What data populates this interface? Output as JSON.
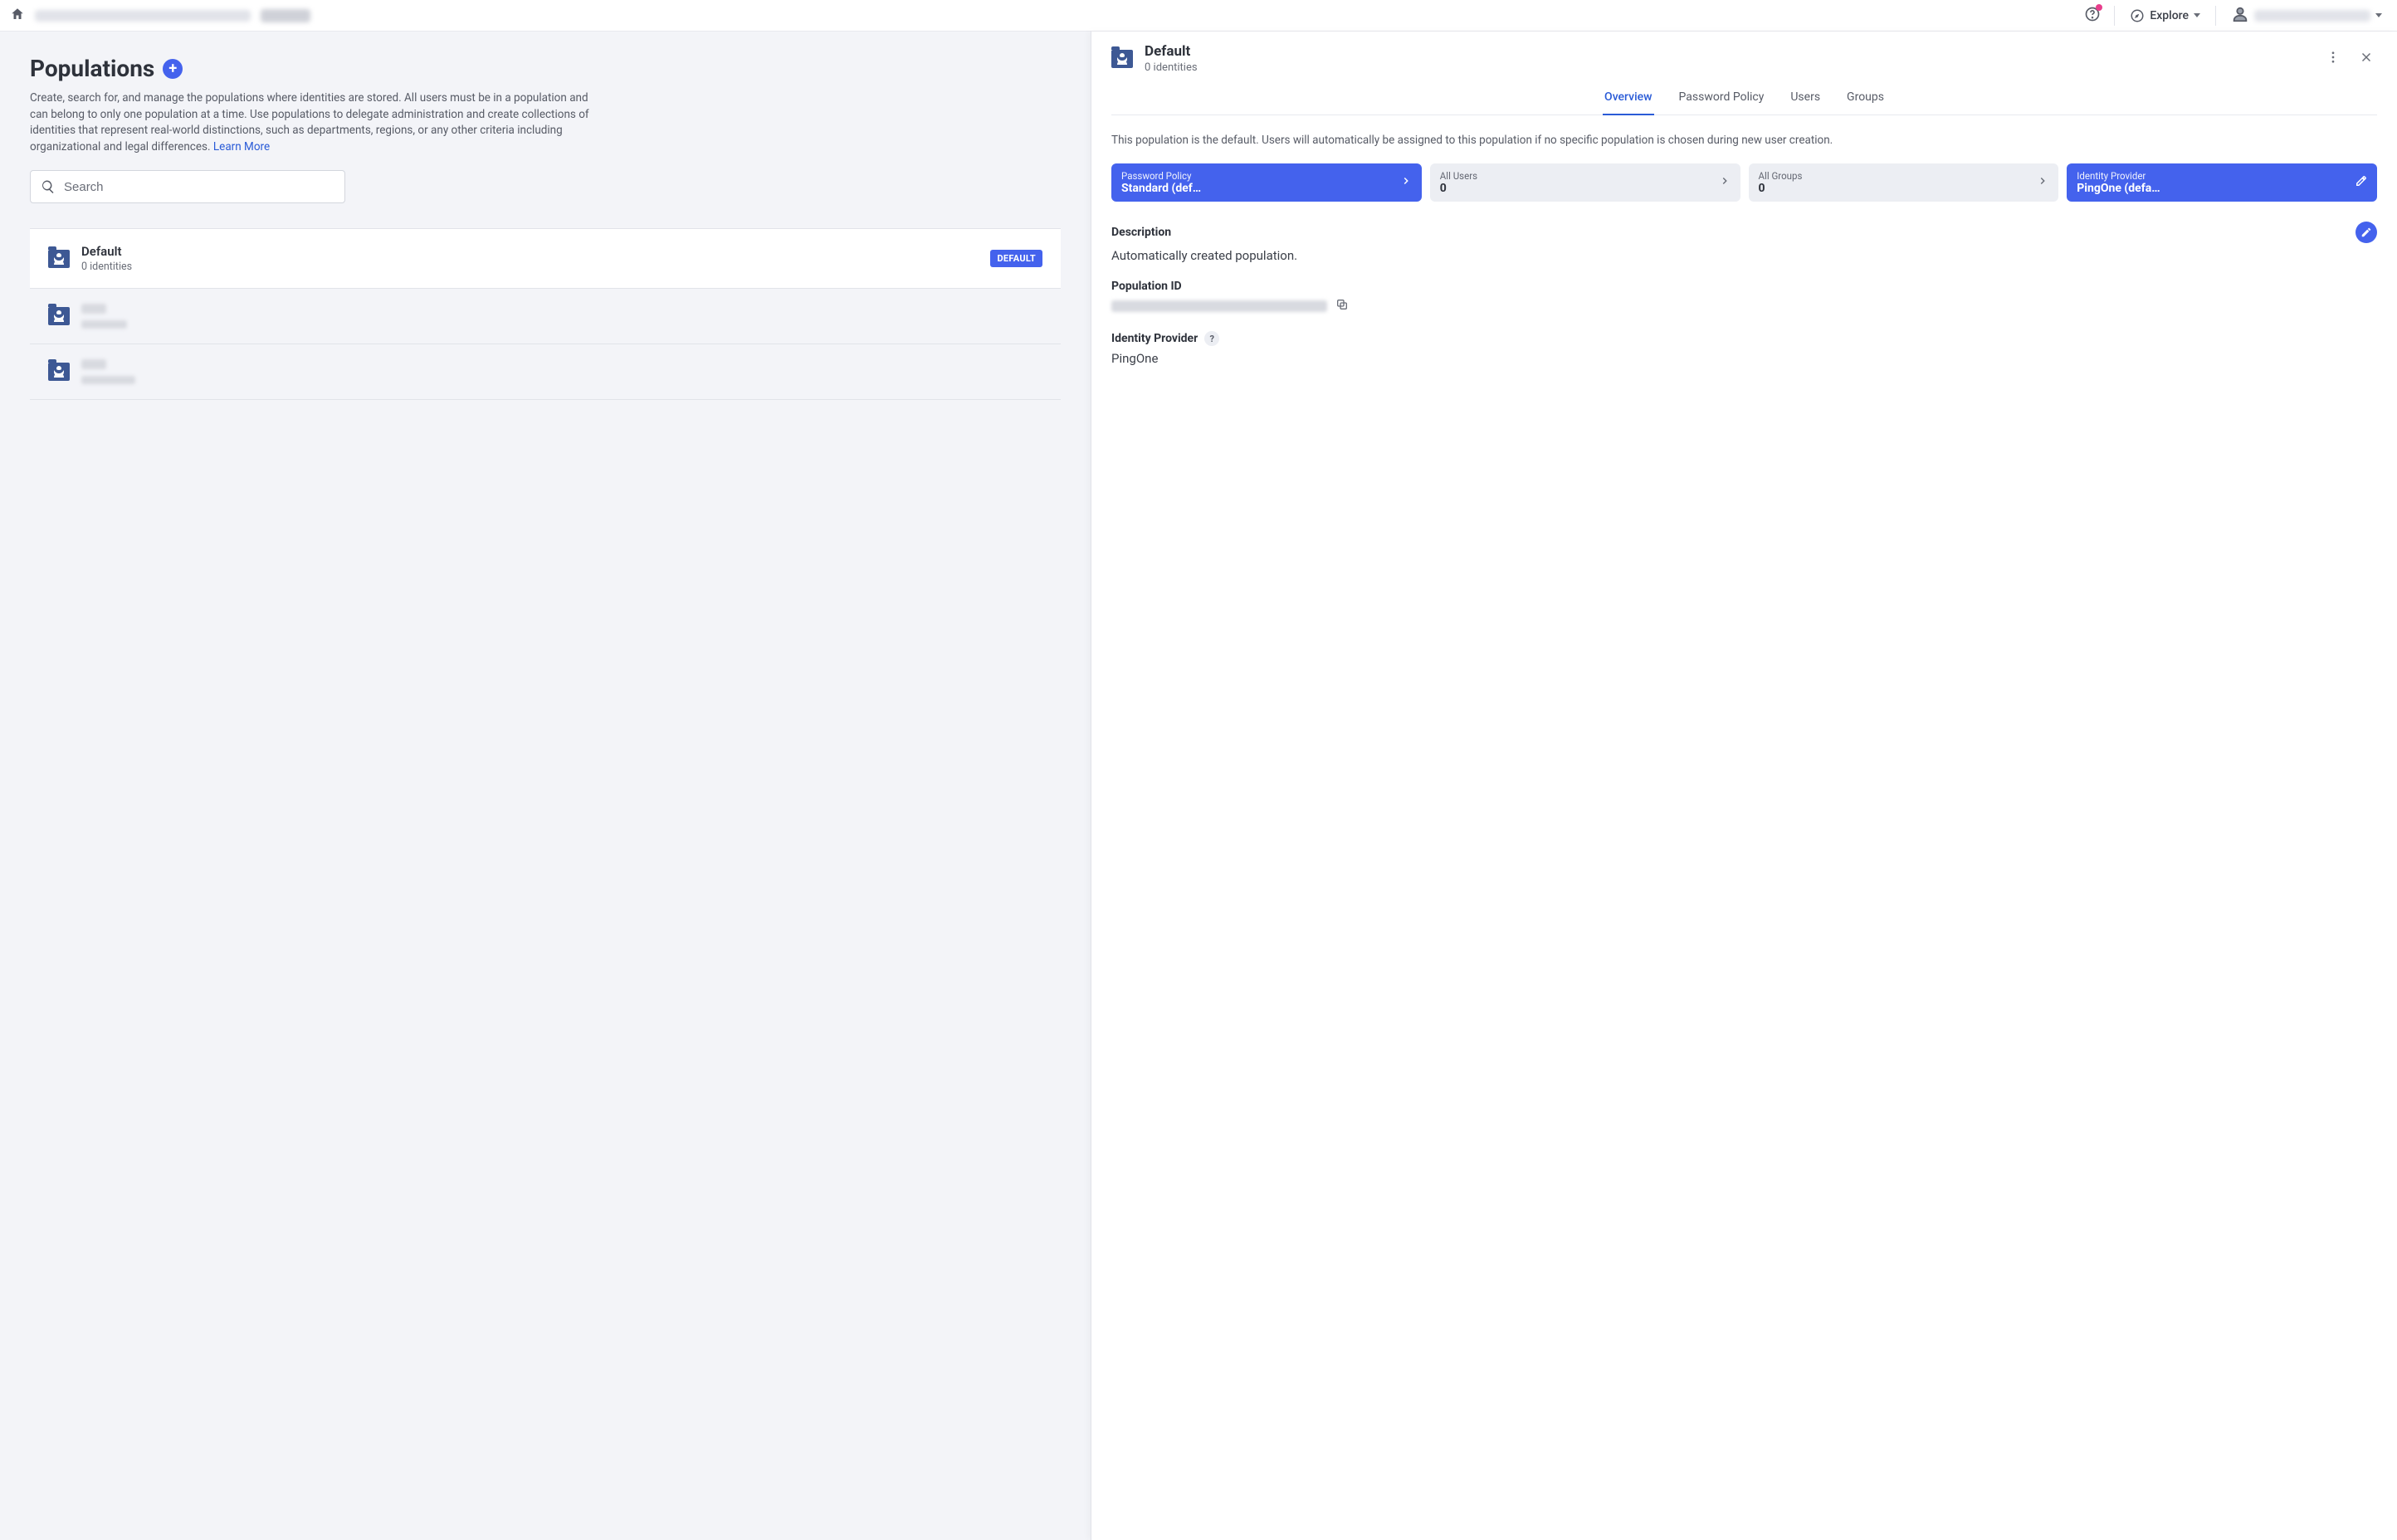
{
  "topbar": {
    "explore_label": "Explore"
  },
  "page": {
    "title": "Populations",
    "description": "Create, search for, and manage the populations where identities are stored. All users must be in a population and can belong to only one population at a time. Use populations to delegate administration and create collections of identities that represent real-world distinctions, such as departments, regions, or any other criteria including organizational and legal differences.",
    "learn_more": "Learn More",
    "search_placeholder": "Search"
  },
  "list": [
    {
      "name": "Default",
      "sub": "0 identities",
      "badge": "DEFAULT",
      "selected": true
    },
    {
      "name": "",
      "sub": "",
      "blurred": true
    },
    {
      "name": "",
      "sub": "",
      "blurred": true
    }
  ],
  "detail": {
    "title": "Default",
    "sub": "0 identities",
    "tabs": [
      "Overview",
      "Password Policy",
      "Users",
      "Groups"
    ],
    "active_tab": 0,
    "infobox": "This population is the default. Users will automatically be assigned to this population if no specific population is chosen during new user creation.",
    "cards": [
      {
        "label": "Password Policy",
        "value": "Standard (def…",
        "style": "primary",
        "icon": "chevron"
      },
      {
        "label": "All Users",
        "value": "0",
        "style": "light",
        "icon": "chevron"
      },
      {
        "label": "All Groups",
        "value": "0",
        "style": "light",
        "icon": "chevron"
      },
      {
        "label": "Identity Provider",
        "value": "PingOne (defa…",
        "style": "primary",
        "icon": "pencil"
      }
    ],
    "sections": {
      "description": {
        "title": "Description",
        "value": "Automatically created population."
      },
      "population_id": {
        "title": "Population ID"
      },
      "idp": {
        "title": "Identity Provider",
        "value": "PingOne"
      }
    }
  }
}
